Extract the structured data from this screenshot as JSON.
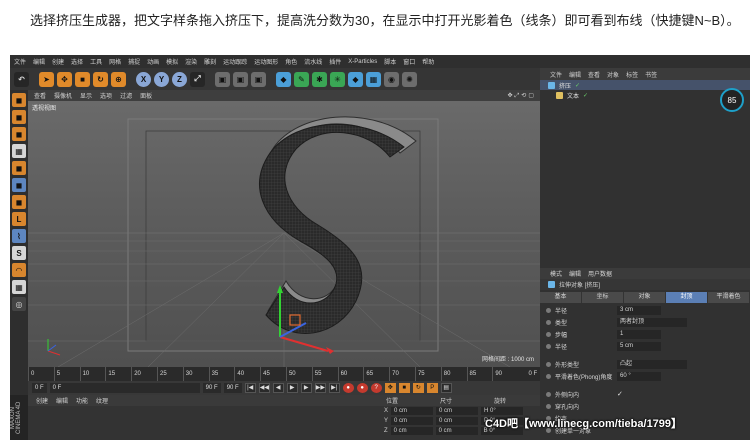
{
  "caption": "选择挤压生成器，把文字样条拖入挤压下，提高洗分数为30，在显示中打开光影着色（线条）即可看到布线（快捷键N~B）。",
  "menu": [
    "文件",
    "编辑",
    "创建",
    "选择",
    "工具",
    "网格",
    "捕捉",
    "动画",
    "模拟",
    "渲染",
    "雕刻",
    "运动跟踪",
    "运动图形",
    "角色",
    "流水线",
    "插件",
    "X-Particles",
    "脚本",
    "窗口",
    "帮助"
  ],
  "toolbar": {
    "undo": "↶",
    "axes": [
      "X",
      "Y",
      "Z"
    ],
    "extra": "⊕"
  },
  "viewport": {
    "menu": [
      "查看",
      "摄像机",
      "显示",
      "选项",
      "过滤",
      "面板"
    ],
    "label": "透视视图",
    "grid_spacing": "网格间距 : 1000 cm"
  },
  "timeline": {
    "ticks": [
      "0",
      "5",
      "10",
      "15",
      "20",
      "25",
      "30",
      "35",
      "40",
      "45",
      "50",
      "55",
      "60",
      "65",
      "70",
      "75",
      "80",
      "85",
      "90"
    ],
    "frame": "0 F"
  },
  "transport": {
    "start": "0 F",
    "current": "0 F",
    "end": "90 F",
    "max": "90 F"
  },
  "material": {
    "tabs": [
      "创建",
      "编辑",
      "功能",
      "纹理"
    ]
  },
  "coords": {
    "headers": [
      "位置",
      "尺寸",
      "旋转"
    ],
    "rows": [
      {
        "axis": "X",
        "pos": "0 cm",
        "size": "0 cm",
        "rot": "H 0°"
      },
      {
        "axis": "Y",
        "pos": "0 cm",
        "size": "0 cm",
        "rot": "P 0°"
      },
      {
        "axis": "Z",
        "pos": "0 cm",
        "size": "0 cm",
        "rot": "B 0°"
      }
    ]
  },
  "side_label": "MAXON CINEMA 4D",
  "object_manager": {
    "tabs": [
      "文件",
      "编辑",
      "查看",
      "对象",
      "标签",
      "书签"
    ],
    "items": [
      {
        "name": "挤压",
        "color": "#6bb6e8"
      },
      {
        "name": "文本",
        "color": "#e0c060"
      }
    ]
  },
  "badge": "85",
  "attributes": {
    "tabs_top": [
      "模式",
      "编辑",
      "用户数据"
    ],
    "title": "拉伸对象 [挤压]",
    "tabs": [
      "基本",
      "坐标",
      "对象",
      "封顶",
      "平滑着色"
    ],
    "rows1": [
      {
        "label": "半径",
        "value": "3 cm"
      },
      {
        "label": "类型",
        "value": "两者封顶"
      },
      {
        "label": "步幅",
        "value": "1"
      },
      {
        "label": "半径",
        "value": "5 cm"
      }
    ],
    "rows2": [
      {
        "label": "外形类型",
        "value": "凸起"
      },
      {
        "label": "平滑着色(Phong)角度",
        "value": "60 °"
      }
    ],
    "rows3": [
      {
        "label": "外侧向内",
        "check": "✓"
      },
      {
        "label": "穿孔向内",
        "check": ""
      },
      {
        "label": "约束",
        "check": ""
      },
      {
        "label": "创建单一对象",
        "check": ""
      }
    ]
  },
  "watermark": "C4D吧【www.linecg.com/tieba/1799】"
}
